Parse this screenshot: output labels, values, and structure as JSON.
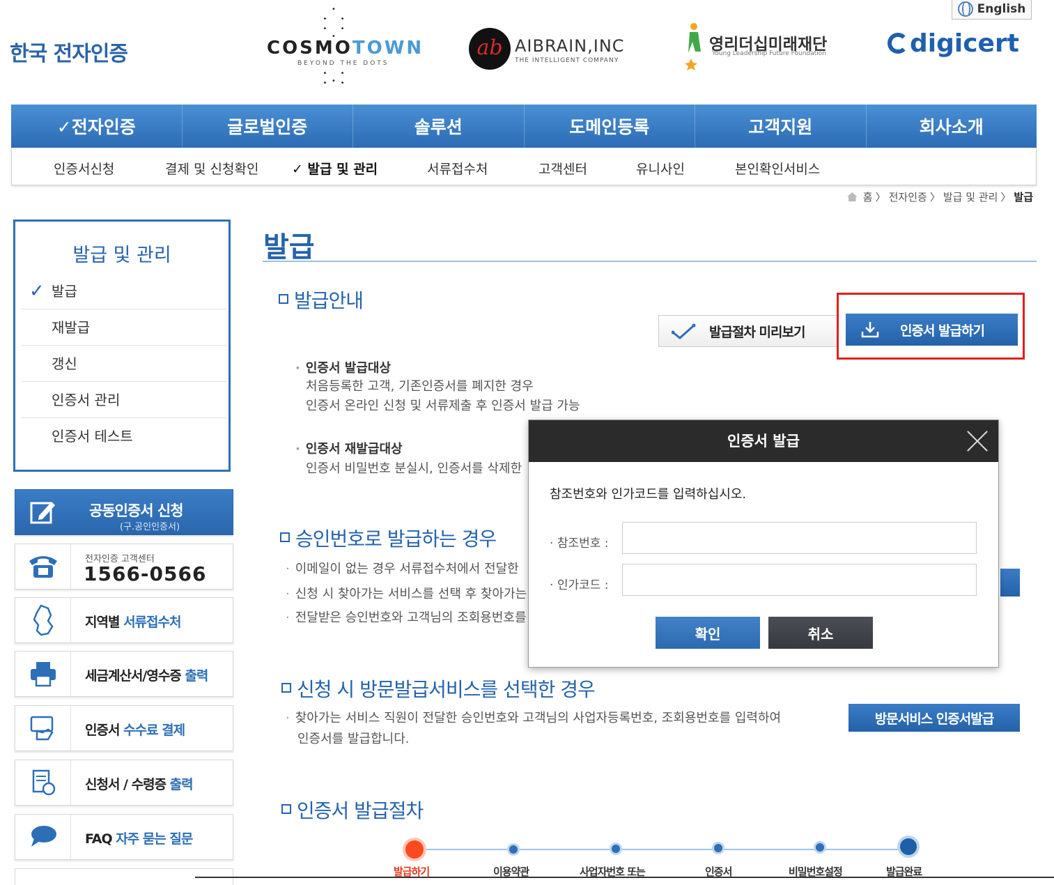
{
  "header": {
    "logos": {
      "korea": "한국 전자인증",
      "cosmotown": {
        "name_a": "COSMO",
        "name_b": "TOWN",
        "tagline": "BEYOND THE DOTS"
      },
      "aibrain": {
        "name": "AIBRAIN,INC",
        "tagline": "THE INTELLIGENT COMPANY",
        "mark": "ab"
      },
      "young": {
        "name": "영리더십미래재단",
        "tagline": "Young Leadership Future Foundation"
      },
      "digicert": "digicert"
    },
    "lang_label": "English"
  },
  "mainnav": [
    "✓전자인증",
    "글로벌인증",
    "솔루션",
    "도메인등록",
    "고객지원",
    "회사소개"
  ],
  "subnav": [
    "인증서신청",
    "결제 및 신청확인",
    "✓ 발급 및 관리",
    "서류접수처",
    "고객센터",
    "유니사인",
    "본인확인서비스"
  ],
  "breadcrumb": [
    "홈",
    "전자인증",
    "발급 및 관리",
    "발급"
  ],
  "sidebar": {
    "title": "발급 및 관리",
    "items": [
      "발급",
      "재발급",
      "갱신",
      "인증서 관리",
      "인증서 테스트"
    ],
    "quick": {
      "apply": {
        "label": "공동인증서 신청",
        "sub": "(구.공인인증서)"
      },
      "phone": {
        "label": "전자인증 고객센터",
        "number": "1566-0566"
      },
      "region": {
        "a": "지역별 ",
        "b": "서류접수처"
      },
      "tax": {
        "a": "세금계산서/영수증 ",
        "b": "출력"
      },
      "fee": {
        "a": "인증서 ",
        "b": "수수료 결제"
      },
      "form": {
        "a": "신청서 / 수령증 ",
        "b": "출력"
      },
      "faq": {
        "a": "FAQ ",
        "b": "자주 묻는 질문"
      }
    }
  },
  "content": {
    "title": "발급",
    "sec1": {
      "title": "발급안내",
      "preview_btn": "발급절차 미리보기",
      "issue_btn": "인증서 발급하기",
      "b1_head": "인증서 발급대상",
      "b1_l1": "처음등록한 고객, 기존인증서를 폐지한 경우",
      "b1_l2": "인증서 온라인 신청 및 서류제출 후 인증서 발급 가능",
      "b2_head": "인증서 재발급대상",
      "b2_l1": "인증서 비밀번호 분실시, 인증서를 삭제한"
    },
    "sec2": {
      "title": "승인번호로 발급하는 경우",
      "l1": "이메일이 없는 경우 서류접수처에서 전달한",
      "l2": "신청 시 찾아가는 서비스를 선택 후 찾아가는",
      "l3": "전달받은 승인번호와 고객님의 조회용번호를"
    },
    "sec3": {
      "title": "신청 시 방문발급서비스를 선택한 경우",
      "l1": "찾아가는 서비스 직원이 전달한 승인번호와 고객님의 사업자등록번호, 조회용번호를 입력하여",
      "l2": "인증서를 발급합니다.",
      "btn": "방문서비스 인증서발급"
    },
    "sec4": {
      "title": "인증서 발급절차",
      "steps": [
        "발급하기",
        "이용약관",
        "사업자번호 또는",
        "인증서",
        "비밀번호설정",
        "발급완료"
      ]
    }
  },
  "modal": {
    "title": "인증서 발급",
    "prompt": "참조번호와 인가코드를 입력하십시오.",
    "ref_label": "참조번호 :",
    "ref_value": "",
    "auth_label": "인가코드 :",
    "auth_value": "",
    "ok": "확인",
    "cancel": "취소"
  },
  "colors": {
    "brand": "#2563ac",
    "highlight": "#e01f1f",
    "accent_step": "#ff4a1f"
  }
}
